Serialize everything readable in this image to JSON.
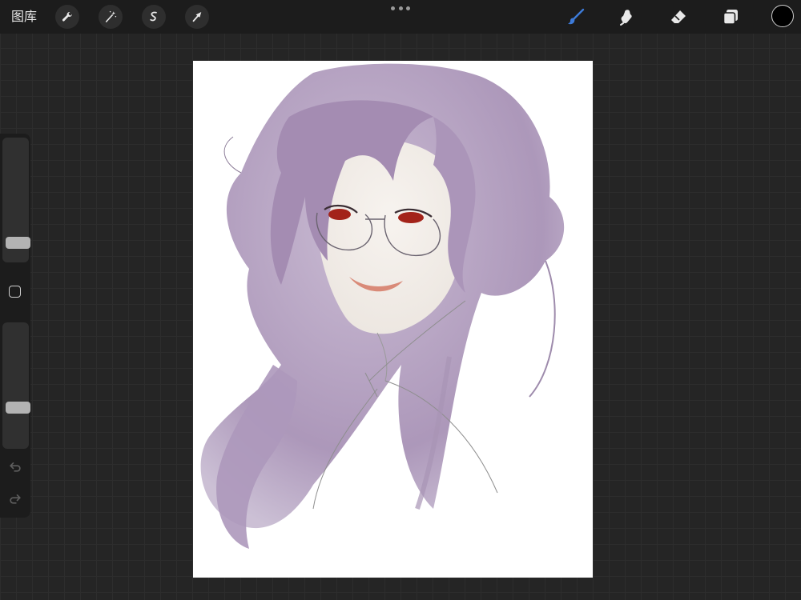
{
  "topbar": {
    "gallery_label": "图库",
    "left_tools": [
      "wrench-icon",
      "magic-wand-icon",
      "selection-icon",
      "transform-arrow-icon"
    ],
    "right_tools": [
      "brush-icon",
      "smudge-icon",
      "eraser-icon",
      "layers-icon"
    ],
    "active_tool": "brush-icon",
    "accent_color": "#3d7bd9",
    "current_color": "#000000"
  },
  "sidebar": {
    "brush_size_level": 0.1,
    "opacity_level": 0.3
  },
  "canvas": {
    "background": "#ffffff",
    "hair_color": "#b3a1bf",
    "eye_color": "#a3231a"
  }
}
